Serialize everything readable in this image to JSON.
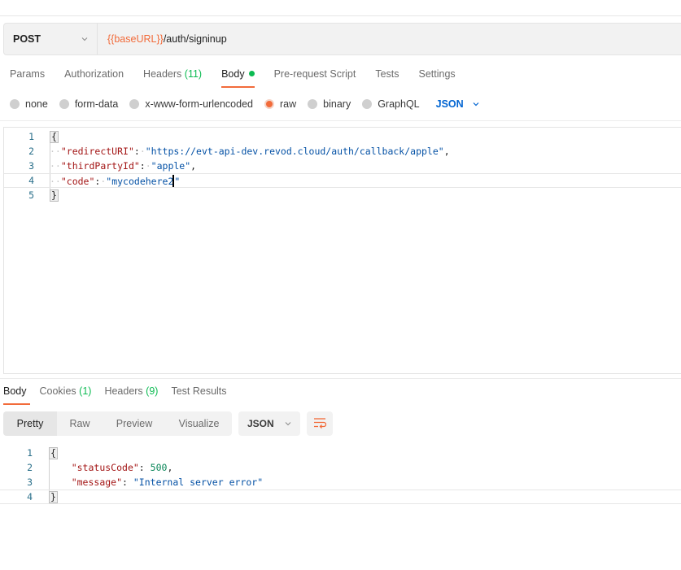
{
  "request": {
    "method": "POST",
    "url_variable": "{{baseURL}}",
    "url_path": "/auth/signinup"
  },
  "request_tabs": [
    {
      "label": "Params"
    },
    {
      "label": "Authorization"
    },
    {
      "label": "Headers",
      "count": "(11)"
    },
    {
      "label": "Body",
      "active": true,
      "indicator": "green-dot"
    },
    {
      "label": "Pre-request Script"
    },
    {
      "label": "Tests"
    },
    {
      "label": "Settings"
    }
  ],
  "body_types": {
    "options": [
      "none",
      "form-data",
      "x-www-form-urlencoded",
      "raw",
      "binary",
      "GraphQL"
    ],
    "selected": "raw",
    "language": "JSON"
  },
  "request_body": {
    "lines": [
      {
        "n": "1",
        "open": "{"
      },
      {
        "n": "2",
        "key": "\"redirectURI\"",
        "value": "\"https://evt-api-dev.revod.cloud/auth/callback/apple\"",
        "trail": ","
      },
      {
        "n": "3",
        "key": "\"thirdPartyId\"",
        "value": "\"apple\"",
        "trail": ","
      },
      {
        "n": "4",
        "key": "\"code\"",
        "value_before_cursor": "\"mycodehere2",
        "value_after_cursor": "\""
      },
      {
        "n": "5",
        "close": "}"
      }
    ]
  },
  "response_tabs": [
    {
      "label": "Body",
      "active": true
    },
    {
      "label": "Cookies",
      "count": "(1)"
    },
    {
      "label": "Headers",
      "count": "(9)"
    },
    {
      "label": "Test Results"
    }
  ],
  "response_view": {
    "modes": [
      "Pretty",
      "Raw",
      "Preview",
      "Visualize"
    ],
    "active_mode": "Pretty",
    "format": "JSON",
    "wrap_icon": "wrap-lines-icon"
  },
  "response_body": {
    "lines": [
      {
        "n": "1",
        "open": "{"
      },
      {
        "n": "2",
        "key": "\"statusCode\"",
        "value": "500",
        "trail": ","
      },
      {
        "n": "3",
        "key": "\"message\"",
        "value": "\"Internal server error\""
      },
      {
        "n": "4",
        "close": "}"
      }
    ]
  },
  "colors": {
    "accent": "#f26b3a",
    "success": "#0cbb52",
    "link": "#0265d2",
    "json_key": "#a31515",
    "json_string": "#0451a5",
    "json_number": "#098658"
  }
}
